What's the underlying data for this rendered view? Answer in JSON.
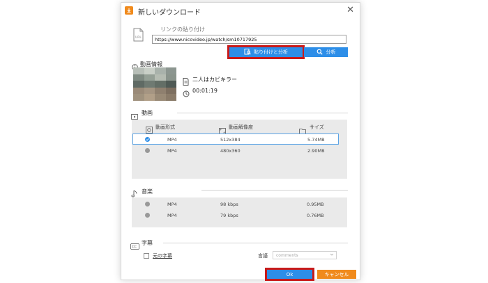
{
  "window": {
    "title": "新しいダウンロード",
    "close": "✕"
  },
  "link": {
    "label": "リンクの貼り付け",
    "url": "https://www.nicovideo.jp/watch/sm10717925"
  },
  "buttons": {
    "paste_analyze": "貼り付けと分析",
    "analyze": "分析",
    "ok": "Ok",
    "cancel": "キャンセル"
  },
  "video_info": {
    "label": "動画情報",
    "title": "二人はカビキラー",
    "duration": "00:01:19"
  },
  "video": {
    "label": "動画",
    "columns": [
      "動画形式",
      "動画解像度",
      "サイズ"
    ],
    "rows": [
      {
        "format": "MP4",
        "resolution": "512x384",
        "size": "5.74MB",
        "selected": true
      },
      {
        "format": "MP4",
        "resolution": "480x360",
        "size": "2.90MB",
        "selected": false
      }
    ]
  },
  "audio": {
    "label": "音楽",
    "rows": [
      {
        "format": "MP4",
        "bitrate": "98 kbps",
        "size": "0.95MB"
      },
      {
        "format": "MP4",
        "bitrate": "79 kbps",
        "size": "0.76MB"
      }
    ]
  },
  "subtitles": {
    "label": "字幕",
    "original_label": "元の字幕",
    "language_label": "言語",
    "language_placeholder": "comments"
  },
  "colors": {
    "accent": "#2d8ee8",
    "cancel": "#f08a1c",
    "highlight": "#c81a1a",
    "panel": "#eaeaea"
  }
}
